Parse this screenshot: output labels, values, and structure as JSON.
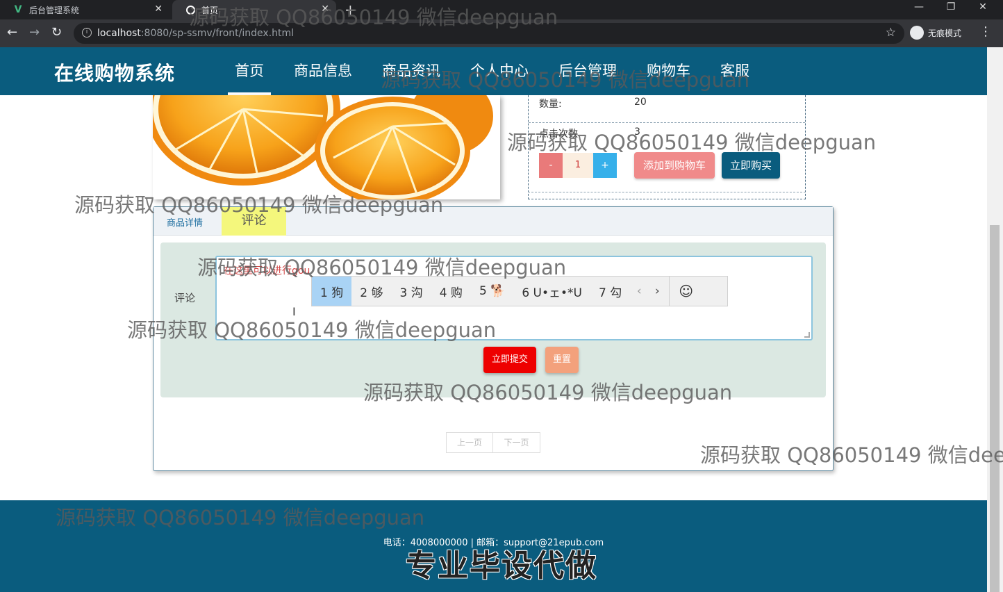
{
  "browser": {
    "tabs": [
      {
        "title": "后台管理系统",
        "active": false
      },
      {
        "title": "首页",
        "active": true
      }
    ],
    "url_host": "localhost",
    "url_rest": ":8080/sp-ssmv/front/index.html",
    "incognito_label": "无痕模式"
  },
  "site": {
    "logo": "在线购物系统",
    "nav": [
      "首页",
      "商品信息",
      "商品资讯",
      "个人中心",
      "后台管理",
      "购物车",
      "客服"
    ],
    "active_nav": "首页"
  },
  "product": {
    "rows": [
      {
        "label": "数量:",
        "value": "20"
      },
      {
        "label": "点击次数",
        "value": "3"
      }
    ],
    "qty_minus": "-",
    "qty_value": "1",
    "qty_plus": "+",
    "add_to_cart": "添加到购物车",
    "buy_now": "立即购买"
  },
  "tabs": {
    "detail": "商品详情",
    "comment": "评论"
  },
  "comment": {
    "label": "评论",
    "typed_text": "在这里可以进行gou",
    "ime_candidates": [
      "1 狗",
      "2 够",
      "3 沟",
      "4 购",
      "5 🐕",
      "6 U•ェ•*U",
      "7 勾"
    ],
    "ime_prev": "‹",
    "ime_next": "›",
    "ime_emoji": "☺",
    "submit": "立即提交",
    "reset": "重置"
  },
  "pager": {
    "prev": "上一页",
    "next": "下一页"
  },
  "footer": {
    "contact": "电话：4008000000 | 邮箱：support@21epub.com",
    "promo": "专业毕设代做"
  },
  "watermark": "源码获取 QQ86050149 微信deepguan",
  "colors": {
    "brand": "#0a5c7e",
    "comment_tab": "#f4f77c",
    "submit": "#ee0000",
    "reset": "#f3a17c",
    "add_cart": "#f08a8a"
  }
}
